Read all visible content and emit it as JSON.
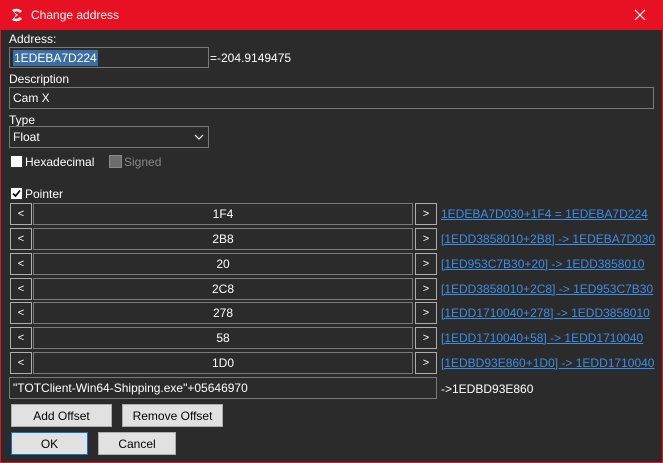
{
  "window": {
    "title": "Change address",
    "app_icon": "cheat-engine-icon",
    "close_icon": "close-icon"
  },
  "address": {
    "label": "Address:",
    "value": "1EDEBA7D224",
    "result": "=-204.9149475"
  },
  "description": {
    "label": "Description",
    "value": "Cam X"
  },
  "type": {
    "label": "Type",
    "selected": "Float",
    "dropdown_icon": "chevron-down-icon"
  },
  "options": {
    "hexadecimal": "Hexadecimal",
    "signed": "Signed",
    "pointer": "Pointer"
  },
  "pointer_rows": [
    {
      "left": "<",
      "offset": "1F4",
      "right": ">",
      "link": "1EDEBA7D030+1F4 = 1EDEBA7D224"
    },
    {
      "left": "<",
      "offset": "2B8",
      "right": ">",
      "link": "[1EDD3858010+2B8] -> 1EDEBA7D030"
    },
    {
      "left": "<",
      "offset": "20",
      "right": ">",
      "link": "[1ED953C7B30+20] -> 1EDD3858010"
    },
    {
      "left": "<",
      "offset": "2C8",
      "right": ">",
      "link": "[1EDD3858010+2C8] -> 1ED953C7B30"
    },
    {
      "left": "<",
      "offset": "278",
      "right": ">",
      "link": "[1EDD1710040+278] -> 1EDD3858010"
    },
    {
      "left": "<",
      "offset": "58",
      "right": ">",
      "link": "[1EDD1710040+58] -> 1EDD1710040"
    },
    {
      "left": "<",
      "offset": "1D0",
      "right": ">",
      "link": "[1EDBD93E860+1D0] -> 1EDD1710040"
    }
  ],
  "base": {
    "value": "\"TOTClient-Win64-Shipping.exe\"+05646970",
    "result": "->1EDBD93E860"
  },
  "buttons": {
    "add_offset": "Add Offset",
    "remove_offset": "Remove Offset",
    "ok": "OK",
    "cancel": "Cancel"
  }
}
